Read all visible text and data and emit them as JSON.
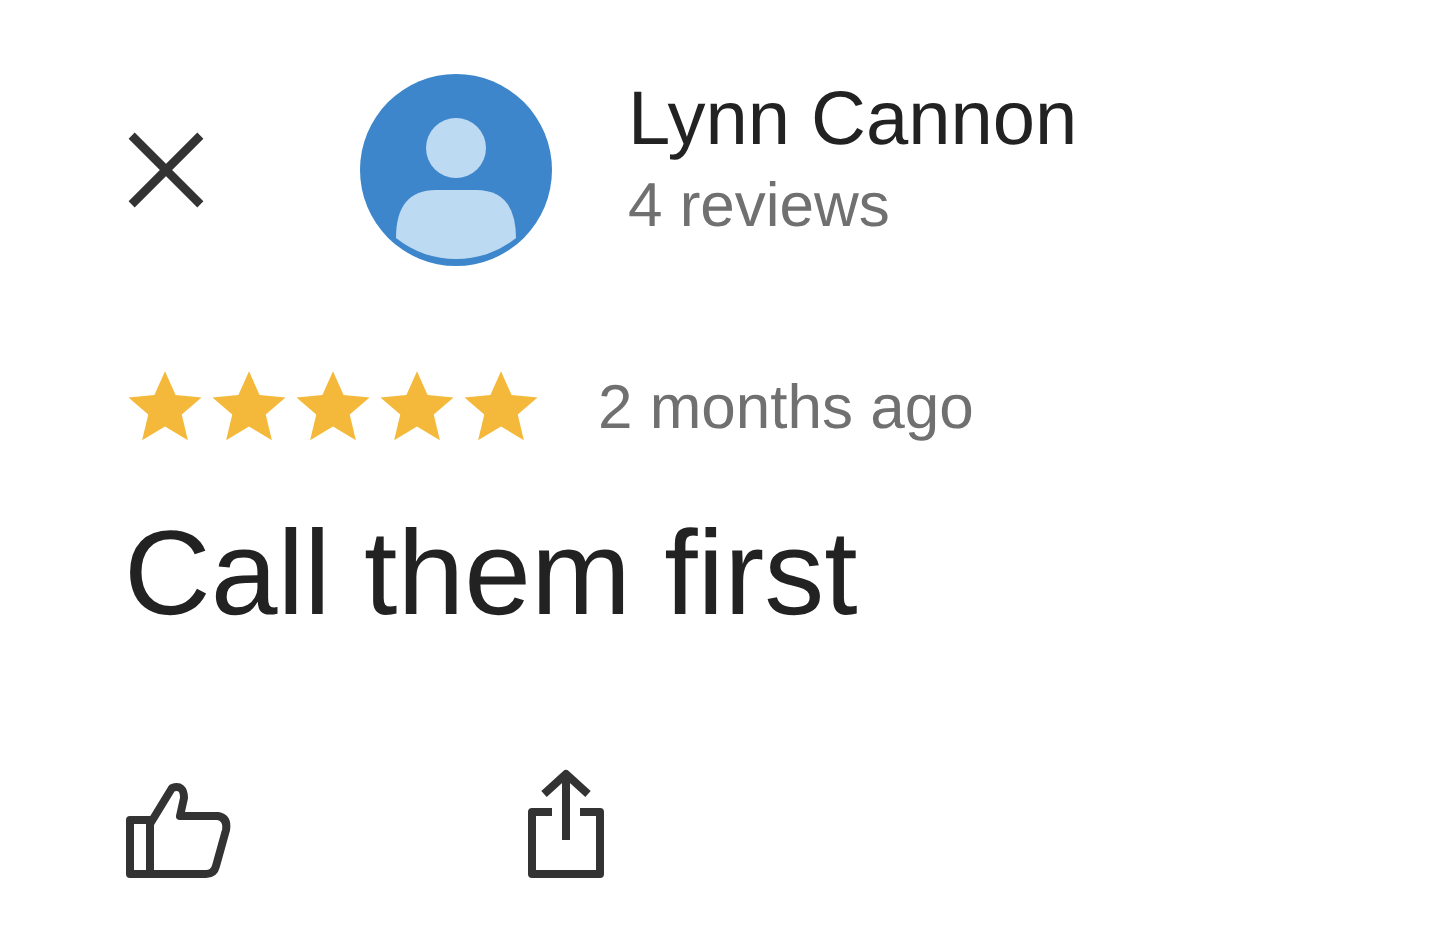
{
  "reviewer": {
    "name": "Lynn Cannon",
    "reviews": "4 reviews"
  },
  "review": {
    "stars": 5,
    "time": "2 months ago",
    "text": "Call them first"
  }
}
